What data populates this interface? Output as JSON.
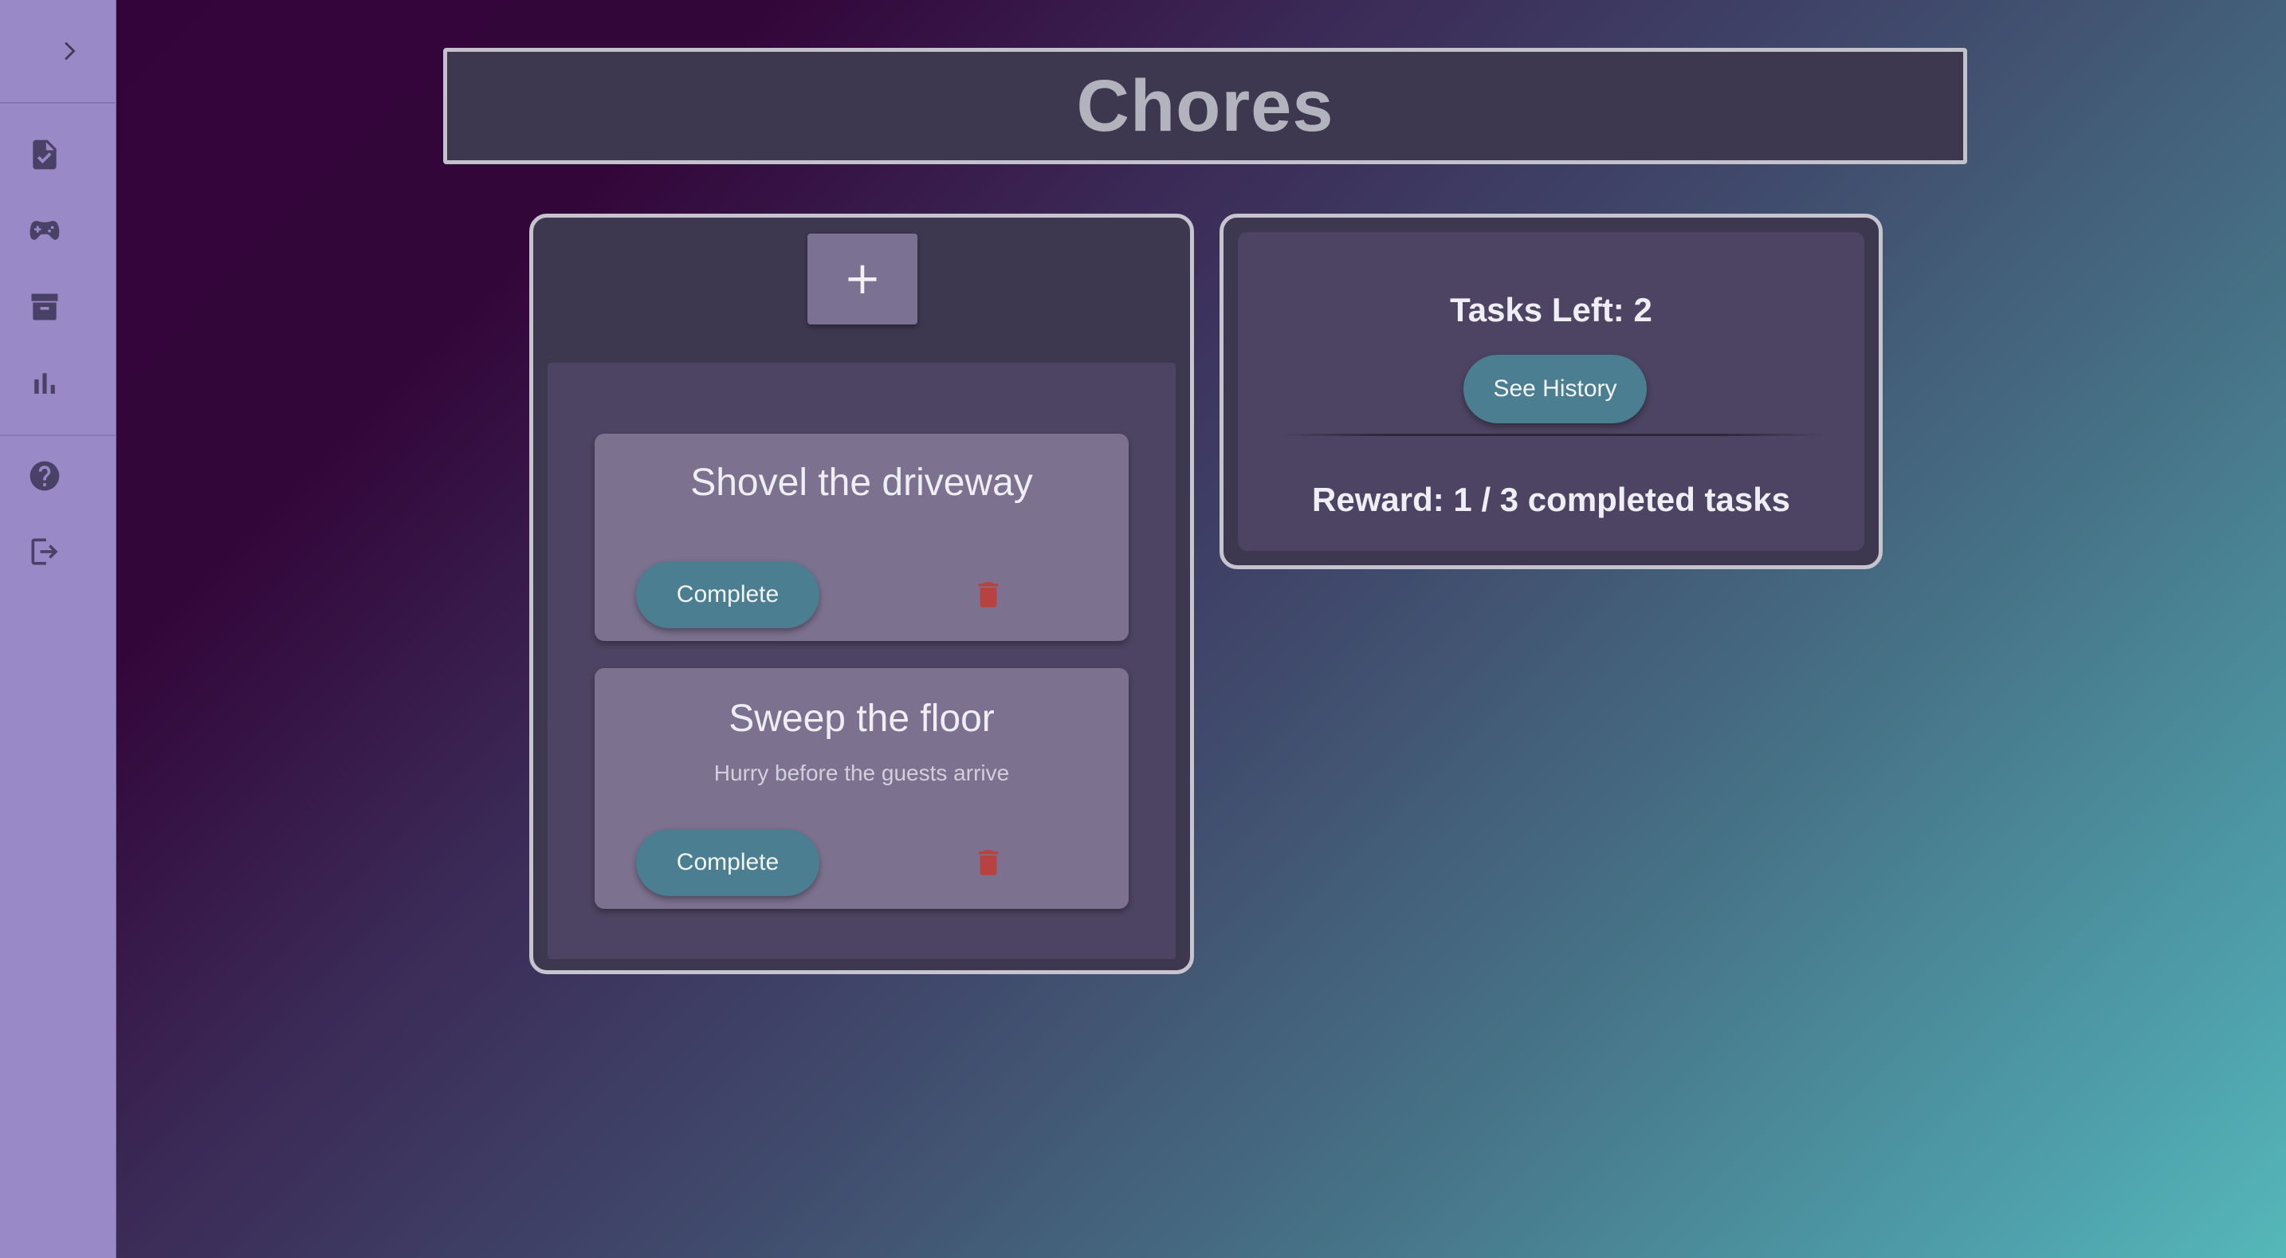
{
  "page": {
    "title": "Chores"
  },
  "sidebar": {
    "toggle_icon": "chevron-right-icon",
    "nav_items": [
      {
        "icon": "task-document-icon"
      },
      {
        "icon": "gamepad-icon"
      },
      {
        "icon": "archive-icon"
      },
      {
        "icon": "bar-chart-icon"
      }
    ],
    "footer_items": [
      {
        "icon": "help-icon"
      },
      {
        "icon": "logout-icon"
      }
    ]
  },
  "tasks_panel": {
    "add_label": "+",
    "tasks": [
      {
        "title": "Shovel the driveway",
        "description": "",
        "complete_label": "Complete"
      },
      {
        "title": "Sweep the floor",
        "description": "Hurry before the guests arrive",
        "complete_label": "Complete"
      }
    ]
  },
  "stats_panel": {
    "tasks_left": "Tasks Left: 2",
    "history_label": "See History",
    "reward": "Reward: 1 / 3 completed tasks"
  },
  "colors": {
    "sidebar": "#9989c6",
    "panel": "#3d374f",
    "accent_button": "#4a7e90",
    "delete": "#b8423f"
  }
}
